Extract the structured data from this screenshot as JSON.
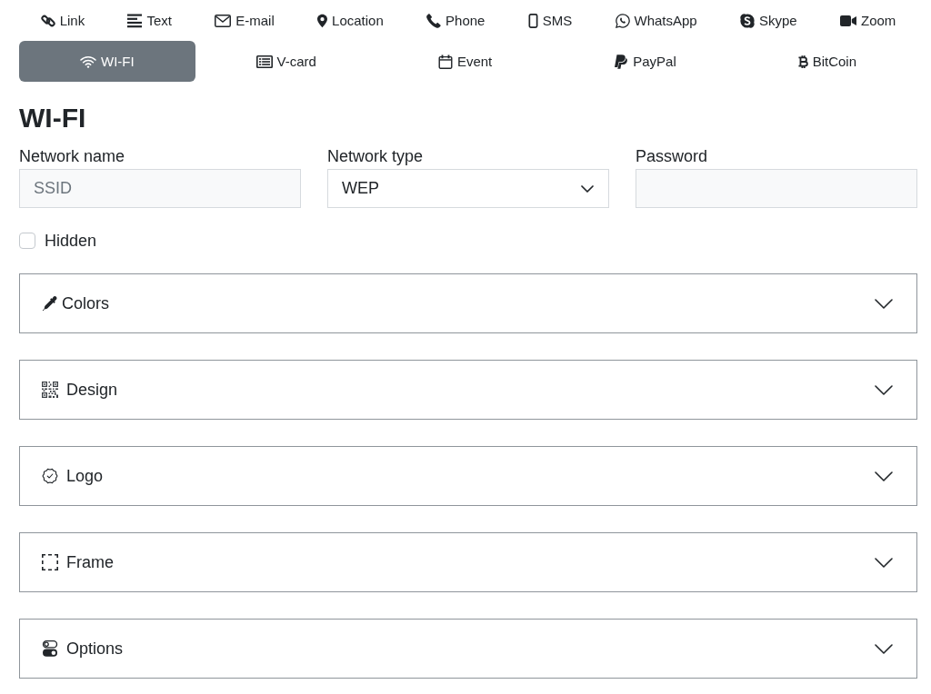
{
  "tab_rows": [
    [
      {
        "label": "Link",
        "selected": false
      },
      {
        "label": "Text",
        "selected": false
      },
      {
        "label": "E-mail",
        "selected": false
      },
      {
        "label": "Location",
        "selected": false
      },
      {
        "label": "Phone",
        "selected": false
      },
      {
        "label": "SMS",
        "selected": false
      },
      {
        "label": "WhatsApp",
        "selected": false
      },
      {
        "label": "Skype",
        "selected": false
      },
      {
        "label": "Zoom",
        "selected": false
      }
    ],
    [
      {
        "label": "WI-FI",
        "selected": true
      },
      {
        "label": "V-card",
        "selected": false
      },
      {
        "label": "Event",
        "selected": false
      },
      {
        "label": "PayPal",
        "selected": false
      },
      {
        "label": "BitCoin",
        "selected": false
      }
    ]
  ],
  "heading": "WI-FI",
  "fields": [
    {
      "kind": "text",
      "label": "Network name",
      "placeholder": "SSID"
    },
    {
      "kind": "select",
      "label": "Network type",
      "value": "WEP"
    },
    {
      "kind": "password",
      "label": "Password"
    }
  ],
  "hidden_option": {
    "label": "Hidden",
    "checked": false
  },
  "sections": [
    {
      "label": "Colors",
      "expanded": false
    },
    {
      "label": "Design",
      "expanded": false
    },
    {
      "label": "Logo",
      "expanded": false
    },
    {
      "label": "Frame",
      "expanded": false
    },
    {
      "label": "Options",
      "expanded": false
    }
  ]
}
